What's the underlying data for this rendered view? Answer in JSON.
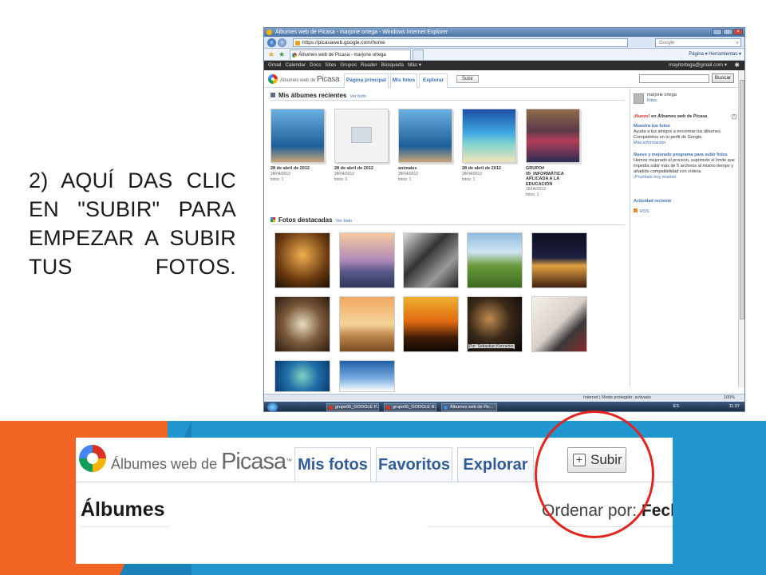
{
  "caption": {
    "number": "2",
    "text": ") AQUÍ DAS CLIC EN \"SUBIR\" PARA EMPEZAR A SUBIR TUS FOTOS."
  },
  "browser": {
    "title": "Álbumes web de Picasa - marjorie ortega - Windows Internet Explorer",
    "url": "https://picasaweb.google.com/home",
    "search_placeholder": "Google",
    "tab_title": "Álbumes web de Picasa - marjorie ortega",
    "ie_tools": "Página ▾  Herramientas ▾",
    "google_bar": [
      "Gmail",
      "Calendar",
      "Docs",
      "Sites",
      "Grupos",
      "Reader",
      "Búsqueda",
      "Más ▾"
    ],
    "account": "mayitortega@gmail.com ▾",
    "status_mode": "Internet | Modo protegido: activado",
    "zoom": "100%",
    "taskbar": [
      "grupo05_GOOGLE P...",
      "grupo05_GOOGLE R...",
      "Álbumes web de Pic..."
    ],
    "lang": "ES",
    "clock": "11:37"
  },
  "picasa": {
    "brand_small": "Álbumes web de",
    "brand_big": "Picasa",
    "tabs": [
      "Página principal",
      "Mis fotos",
      "Explorar"
    ],
    "subir": "Subir",
    "buscar": "Buscar",
    "recent_title": "Mis álbumes recientes",
    "ver_todo": "Ver todo",
    "albums": [
      {
        "title": "28 de abril de 2012",
        "date": "28/04/2012",
        "count": "fotos: 1"
      },
      {
        "title": "28 de abril de 2012",
        "date": "28/04/2012",
        "count": "fotos: 0"
      },
      {
        "title": "animales",
        "date": "28/04/2012",
        "count": "fotos: 1"
      },
      {
        "title": "28 de abril de 2012",
        "date": "28/04/2012",
        "count": "fotos: 1"
      },
      {
        "title": "GRUPO# 05_INFORMÁTICA APLICADA A LA EDUCACIÓN",
        "date": "15/04/2012",
        "count": "fotos: 1"
      }
    ],
    "featured_title": "Fotos destacadas",
    "photo_credit": "Por: Sebastian Kennerkn",
    "sidebar": {
      "user": "marjorie ortega",
      "fotos": "fotos",
      "nuevo": "¡Nuevo!",
      "nuevo_rest": "en Álbumes web de Picasa",
      "muestra": "Muestra tus fotos",
      "muestra_desc": "Ayuda a tus amigos a encontrar tus álbumes. Compártelos en tu perfil de Google.",
      "mas_info": "Más información",
      "nuevo_prog": "Nuevo y mejorado programa para subir fotos",
      "nuevo_prog_desc": "Hemos mejorado el proceso, suprimido el límite que impedía subir más de 5 archivos al mismo tiempo y añadido compatibilidad con vídeos.",
      "pruebalo": "¡Pruébalo hoy mismo!",
      "actividad": "Actividad reciente",
      "rss": "RSS"
    }
  },
  "zoom": {
    "brand_small": "Álbumes web de",
    "brand_big": "Picasa",
    "tm": "™",
    "tabs": [
      "Mis fotos",
      "Favoritos",
      "Explorar"
    ],
    "subir": "Subir",
    "heading": "Álbumes",
    "ordenar": "Ordenar por:",
    "ordenar_value": "Fecha c"
  }
}
